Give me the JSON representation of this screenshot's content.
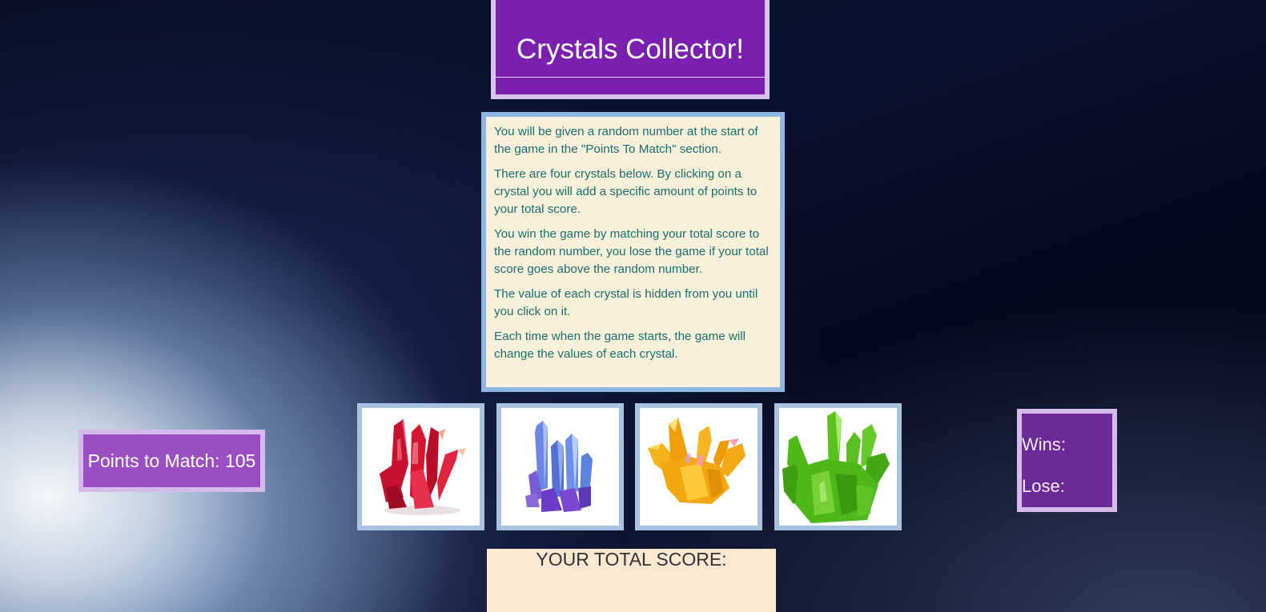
{
  "header": {
    "title": "Crystals Collector!"
  },
  "instructions": [
    "You will be given a random number at the start of the game in the \"Points To Match\" section.",
    "There are four crystals below. By clicking on a crystal you will add a specific amount of points to your total score.",
    "You win the game by matching your total score to the random number, you lose the game if your total score goes above the random number.",
    "The value of each crystal is hidden from you until you click on it.",
    "Each time when the game starts, the game will change the values of each crystal."
  ],
  "target": {
    "label": "Points to Match: ",
    "value": "105"
  },
  "record": {
    "wins_label": "Wins:",
    "wins_value": "",
    "losses_label": "Lose:",
    "losses_value": ""
  },
  "score": {
    "label": "YOUR TOTAL SCORE:",
    "value": ""
  },
  "crystals": [
    {
      "name": "red-crystal",
      "color": "#d4162e"
    },
    {
      "name": "blue-crystal",
      "color": "#5a7be0"
    },
    {
      "name": "yellow-crystal",
      "color": "#f2a80c"
    },
    {
      "name": "green-crystal",
      "color": "#4cb81a"
    }
  ]
}
